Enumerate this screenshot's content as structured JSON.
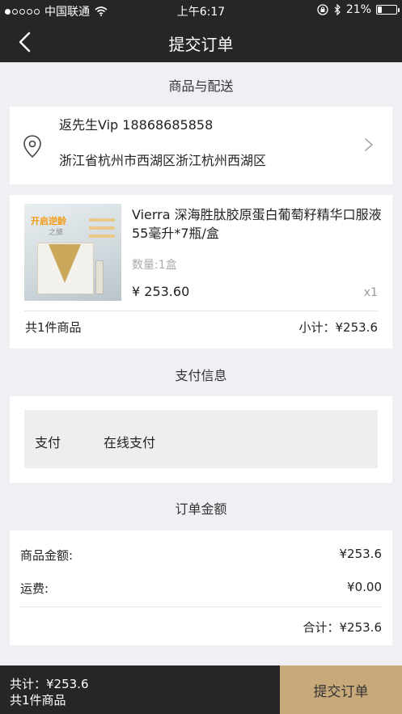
{
  "status_bar": {
    "carrier": "中国联通",
    "time": "上午6:17",
    "battery_percent": "21%",
    "battery_level": 0.21,
    "signal_bars": 1
  },
  "nav": {
    "title": "提交订单",
    "back_icon": "chevron-left-icon"
  },
  "sections": {
    "goods_delivery": "商品与配送",
    "payment_info": "支付信息",
    "order_amount": "订单金额"
  },
  "address": {
    "name_phone": "返先生Vip 18868685858",
    "detail": "浙江省杭州市西湖区浙江杭州西湖区",
    "icon": "location-pin-icon"
  },
  "product": {
    "image_text1": "开启逆龄",
    "image_text2": "之旅",
    "name": "Vierra 深海胜肽胶原蛋白葡萄籽精华口服液 55毫升*7瓶/盒",
    "quantity": "数量:1盒",
    "price": "¥ 253.60",
    "count": "x1",
    "total_items": "共1件商品",
    "subtotal": "小计：¥253.6"
  },
  "payment": {
    "label": "支付",
    "method": "在线支付"
  },
  "amount": {
    "goods_label": "商品金额:",
    "goods_value": "¥253.6",
    "shipping_label": "运费:",
    "shipping_value": "¥0.00",
    "total": "合计：¥253.6"
  },
  "bottom": {
    "total": "共计：¥253.6",
    "count": "共1件商品",
    "submit_label": "提交订单"
  },
  "colors": {
    "header_bg": "#262626",
    "accent": "#c8a97a",
    "page_bg": "#f0eff4"
  }
}
